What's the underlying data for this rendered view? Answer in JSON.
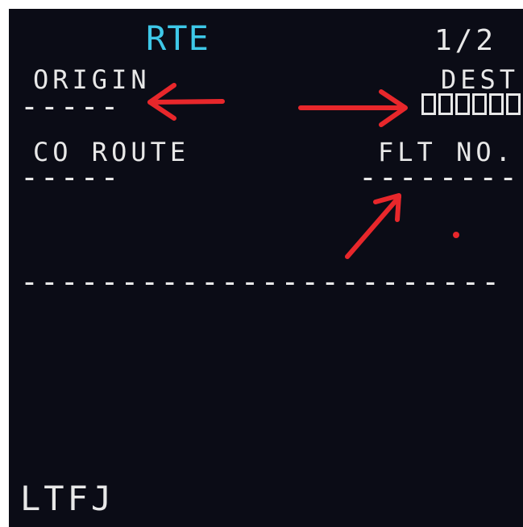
{
  "cdu": {
    "title": "RTE",
    "page": "1/2",
    "origin": {
      "label": "ORIGIN",
      "value": "-----"
    },
    "dest": {
      "label": "DEST",
      "box_count": 6
    },
    "co_route": {
      "label": "CO ROUTE",
      "value": "-----"
    },
    "flt_no": {
      "label": "FLT NO.",
      "value": "--------"
    },
    "separator": "------------------------",
    "scratchpad": "LTFJ"
  },
  "colors": {
    "screen_background": "#0b0c16",
    "title": "#3ec8e8",
    "text": "#e8e8e8",
    "annotation": "#e8272b"
  }
}
